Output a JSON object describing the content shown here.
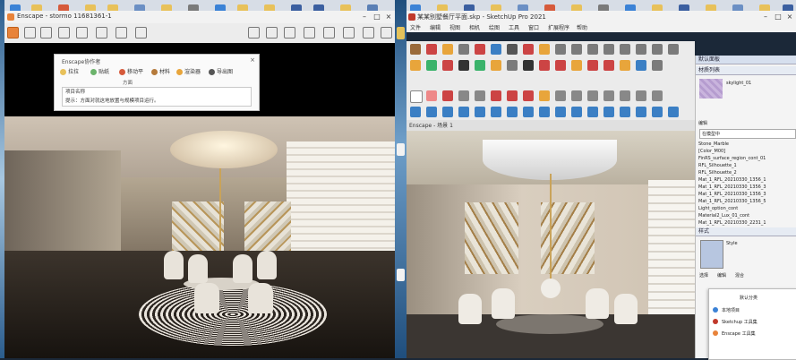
{
  "enscape": {
    "title": "Enscape - stormo 11681361-1",
    "dialog": {
      "title": "Enscape协作者",
      "tools": [
        "拉拉",
        "贴纸",
        "移动平",
        "材料",
        "渲染器",
        "导出图"
      ],
      "subtitle": "方面",
      "field_lines": [
        "项目名称",
        "提示：方面对就这地放置与规模项目运行。"
      ]
    }
  },
  "sketchup": {
    "title": "某某别墅餐厅平面.skp - SketchUp Pro 2021",
    "menus": [
      "文件",
      "编辑",
      "视图",
      "相机",
      "绘图",
      "工具",
      "窗口",
      "扩展程序",
      "帮助"
    ],
    "scene_tab": "Enscape - 场景 1"
  },
  "tray": {
    "header": "默认面板",
    "section1": "材质列表",
    "material_name": "skylight_01",
    "tab_label": "编辑",
    "in_model_label": "在模型中",
    "lines": [
      "Stone_Marble",
      "[Color_M00]",
      "FinRS_surface_region_cont_01",
      "RFL_Silhouette_1",
      "RFL_Silhouette_2",
      "Mat_1_RFL_20210330_1356_1",
      "Mat_1_RFL_20210330_1356_3",
      "Mat_1_RFL_20210330_1356_3",
      "Mat_1_RFL_20210330_1356_5",
      "Light_option_cont",
      "Material2_Lux_01_cont",
      "Mat_1_RFL_20210330_2231_1"
    ],
    "section2": "样式",
    "style_label": "Style",
    "style_tabs": [
      "选择",
      "编辑",
      "混合"
    ],
    "context_title": "默认分类",
    "context_items": [
      "本地项目",
      "Sketchup 工具集",
      "Enscape 工具集"
    ]
  }
}
